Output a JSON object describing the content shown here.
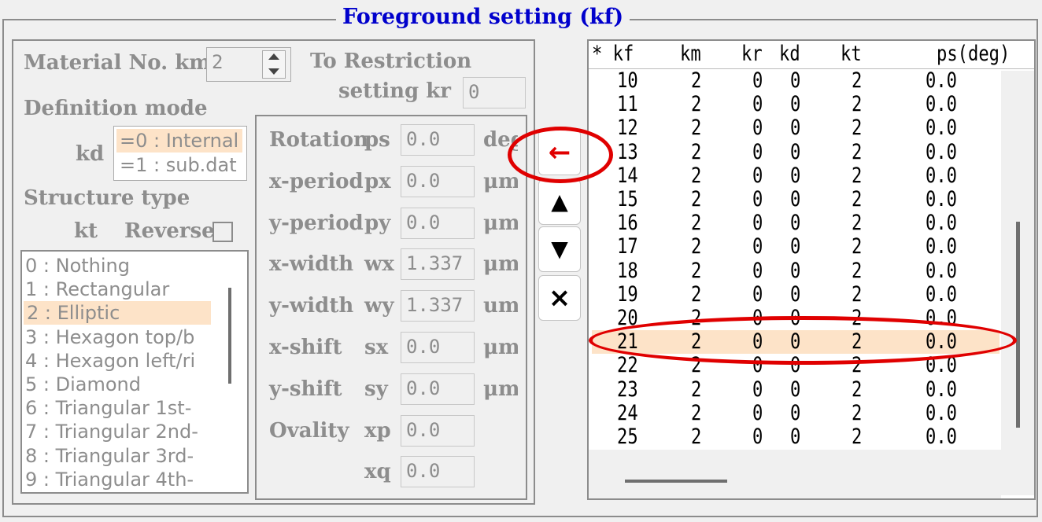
{
  "title": "Foreground setting (kf)",
  "material": {
    "label": "Material No.  km",
    "value": "2"
  },
  "restriction": {
    "label1": "To Restriction",
    "label2": "setting  kr",
    "value": "0"
  },
  "definition_mode": {
    "label": "Definition mode",
    "kd_label": "kd",
    "options": [
      "=0 : Internal",
      "=1 : sub.dat"
    ],
    "selected": 0
  },
  "structure": {
    "label": "Structure type",
    "kt_label": "kt",
    "reverse_label": "Reverse",
    "items": [
      "0 : Nothing",
      "1 : Rectangular",
      "2 : Elliptic",
      "3 : Hexagon top/b",
      "4 : Hexagon left/ri",
      "5 : Diamond",
      "6 : Triangular 1st-",
      "7 : Triangular 2nd-",
      "8 : Triangular 3rd-",
      "9 : Triangular 4th-"
    ],
    "selected": 2
  },
  "params": [
    {
      "label": "Rotation",
      "sym": "ps",
      "value": "0.0",
      "unit": "deg"
    },
    {
      "label": "x-period",
      "sym": "px",
      "value": "0.0",
      "unit": "μm"
    },
    {
      "label": "y-period",
      "sym": "py",
      "value": "0.0",
      "unit": "μm"
    },
    {
      "label": "x-width",
      "sym": "wx",
      "value": "1.337",
      "unit": "μm"
    },
    {
      "label": "y-width",
      "sym": "wy",
      "value": "1.337",
      "unit": "um"
    },
    {
      "label": "x-shift",
      "sym": "sx",
      "value": "0.0",
      "unit": "μm"
    },
    {
      "label": "y-shift",
      "sym": "sy",
      "value": "0.0",
      "unit": "μm"
    },
    {
      "label": "Ovality",
      "sym": "xp",
      "value": "0.0",
      "unit": ""
    },
    {
      "label": "",
      "sym": "xq",
      "value": "0.0",
      "unit": ""
    }
  ],
  "buttons": {
    "insert": "←",
    "up": "▲",
    "down": "▼",
    "delete": "×"
  },
  "table": {
    "headers": [
      "* kf",
      "km",
      "kr",
      "kd",
      "kt",
      "ps(deg)"
    ],
    "rows": [
      [
        "10",
        "2",
        "0",
        "0",
        "2",
        "0.0"
      ],
      [
        "11",
        "2",
        "0",
        "0",
        "2",
        "0.0"
      ],
      [
        "12",
        "2",
        "0",
        "0",
        "2",
        "0.0"
      ],
      [
        "13",
        "2",
        "0",
        "0",
        "2",
        "0.0"
      ],
      [
        "14",
        "2",
        "0",
        "0",
        "2",
        "0.0"
      ],
      [
        "15",
        "2",
        "0",
        "0",
        "2",
        "0.0"
      ],
      [
        "16",
        "2",
        "0",
        "0",
        "2",
        "0.0"
      ],
      [
        "17",
        "2",
        "0",
        "0",
        "2",
        "0.0"
      ],
      [
        "18",
        "2",
        "0",
        "0",
        "2",
        "0.0"
      ],
      [
        "19",
        "2",
        "0",
        "0",
        "2",
        "0.0"
      ],
      [
        "20",
        "2",
        "0",
        "0",
        "2",
        "0.0"
      ],
      [
        "21",
        "2",
        "0",
        "0",
        "2",
        "0.0"
      ],
      [
        "22",
        "2",
        "0",
        "0",
        "2",
        "0.0"
      ],
      [
        "23",
        "2",
        "0",
        "0",
        "2",
        "0.0"
      ],
      [
        "24",
        "2",
        "0",
        "0",
        "2",
        "0.0"
      ],
      [
        "25",
        "2",
        "0",
        "0",
        "2",
        "0.0"
      ]
    ],
    "selected_row": "21"
  },
  "colors": {
    "title": "#0000cc",
    "highlight": "#fde3c8",
    "annotation": "#e00000",
    "disabled_text": "#8d8d8d"
  }
}
